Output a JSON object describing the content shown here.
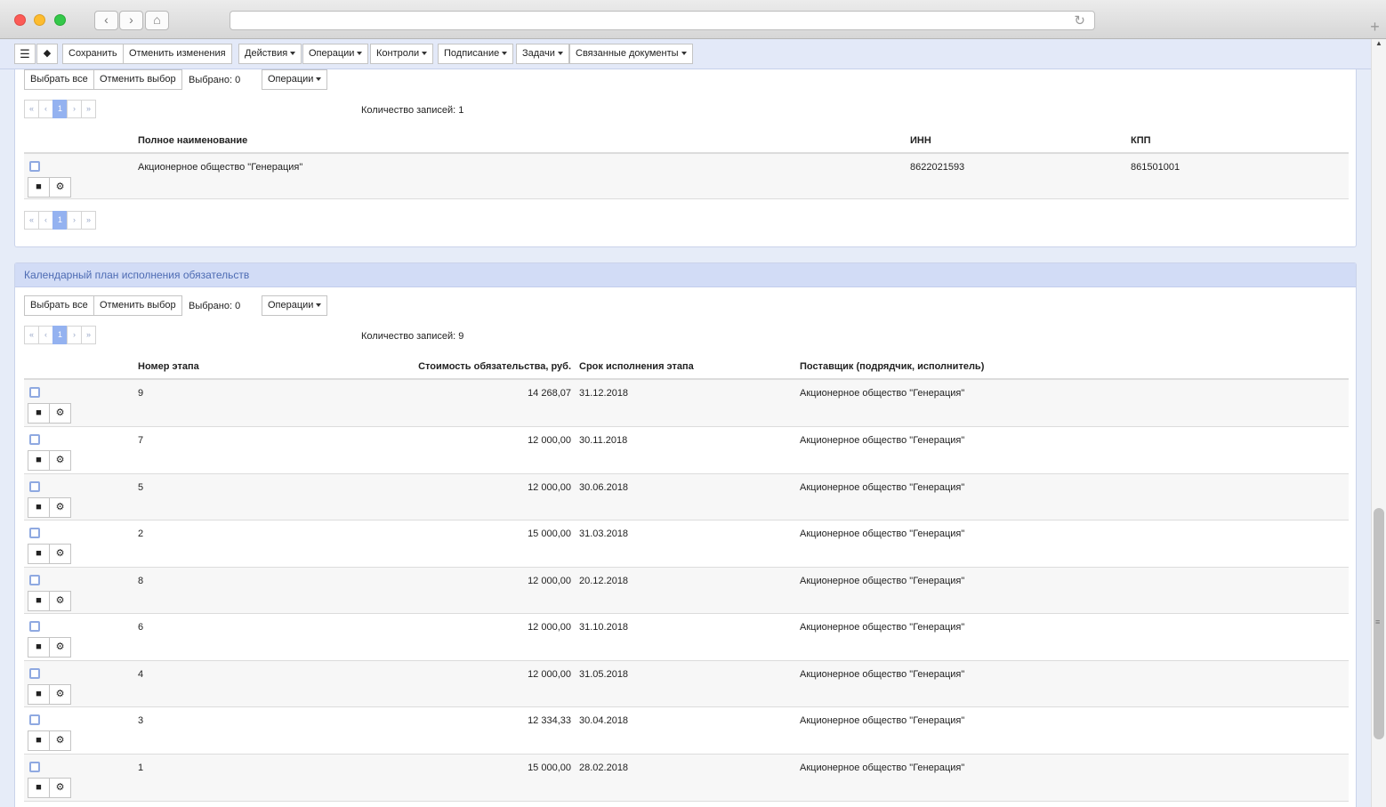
{
  "browser": {
    "reload_icon": "reload-icon",
    "new_tab_label": "+"
  },
  "toolbar": {
    "menu_icon": "hamburger-icon",
    "tag_icon": "tag-icon",
    "buttons": [
      "Сохранить",
      "Отменить изменения",
      "Действия",
      "Операции",
      "Контроли",
      "Подписание",
      "Задачи",
      "Связанные документы"
    ]
  },
  "panel1": {
    "select_all": "Выбрать все",
    "deselect": "Отменить выбор",
    "selected_label": "Выбрано: 0",
    "operations": "Операции",
    "pager": [
      "«",
      "‹",
      "1",
      "›",
      "»"
    ],
    "record_count": "Количество записей: 1",
    "columns": [
      "Полное наименование",
      "ИНН",
      "КПП"
    ],
    "rows": [
      {
        "name": "Акционерное общество \"Генерация\"",
        "inn": "8622021593",
        "kpp": "861501001"
      }
    ]
  },
  "panel2": {
    "title": "Календарный план исполнения обязательств",
    "select_all": "Выбрать все",
    "deselect": "Отменить выбор",
    "selected_label": "Выбрано: 0",
    "operations": "Операции",
    "pager": [
      "«",
      "‹",
      "1",
      "›",
      "»"
    ],
    "record_count": "Количество записей: 9",
    "columns": [
      "Номер этапа",
      "Стоимость обязательства, руб.",
      "Срок исполнения этапа",
      "Поставщик (подрядчик, исполнитель)"
    ],
    "rows": [
      {
        "stage": "9",
        "cost": "14 268,07",
        "date": "31.12.2018",
        "supplier": "Акционерное общество \"Генерация\""
      },
      {
        "stage": "7",
        "cost": "12 000,00",
        "date": "30.11.2018",
        "supplier": "Акционерное общество \"Генерация\""
      },
      {
        "stage": "5",
        "cost": "12 000,00",
        "date": "30.06.2018",
        "supplier": "Акционерное общество \"Генерация\""
      },
      {
        "stage": "2",
        "cost": "15 000,00",
        "date": "31.03.2018",
        "supplier": "Акционерное общество \"Генерация\""
      },
      {
        "stage": "8",
        "cost": "12 000,00",
        "date": "20.12.2018",
        "supplier": "Акционерное общество \"Генерация\""
      },
      {
        "stage": "6",
        "cost": "12 000,00",
        "date": "31.10.2018",
        "supplier": "Акционерное общество \"Генерация\""
      },
      {
        "stage": "4",
        "cost": "12 000,00",
        "date": "31.05.2018",
        "supplier": "Акционерное общество \"Генерация\""
      },
      {
        "stage": "3",
        "cost": "12 334,33",
        "date": "30.04.2018",
        "supplier": "Акционерное общество \"Генерация\""
      },
      {
        "stage": "1",
        "cost": "15 000,00",
        "date": "28.02.2018",
        "supplier": "Акционерное общество \"Генерация\""
      }
    ]
  },
  "row_icons": {
    "document": "document-icon",
    "settings": "gear-icon"
  },
  "colors": {
    "accent": "#94b2f0",
    "panel_header": "#d2dcf6",
    "panel_title": "#4d6bb3"
  }
}
